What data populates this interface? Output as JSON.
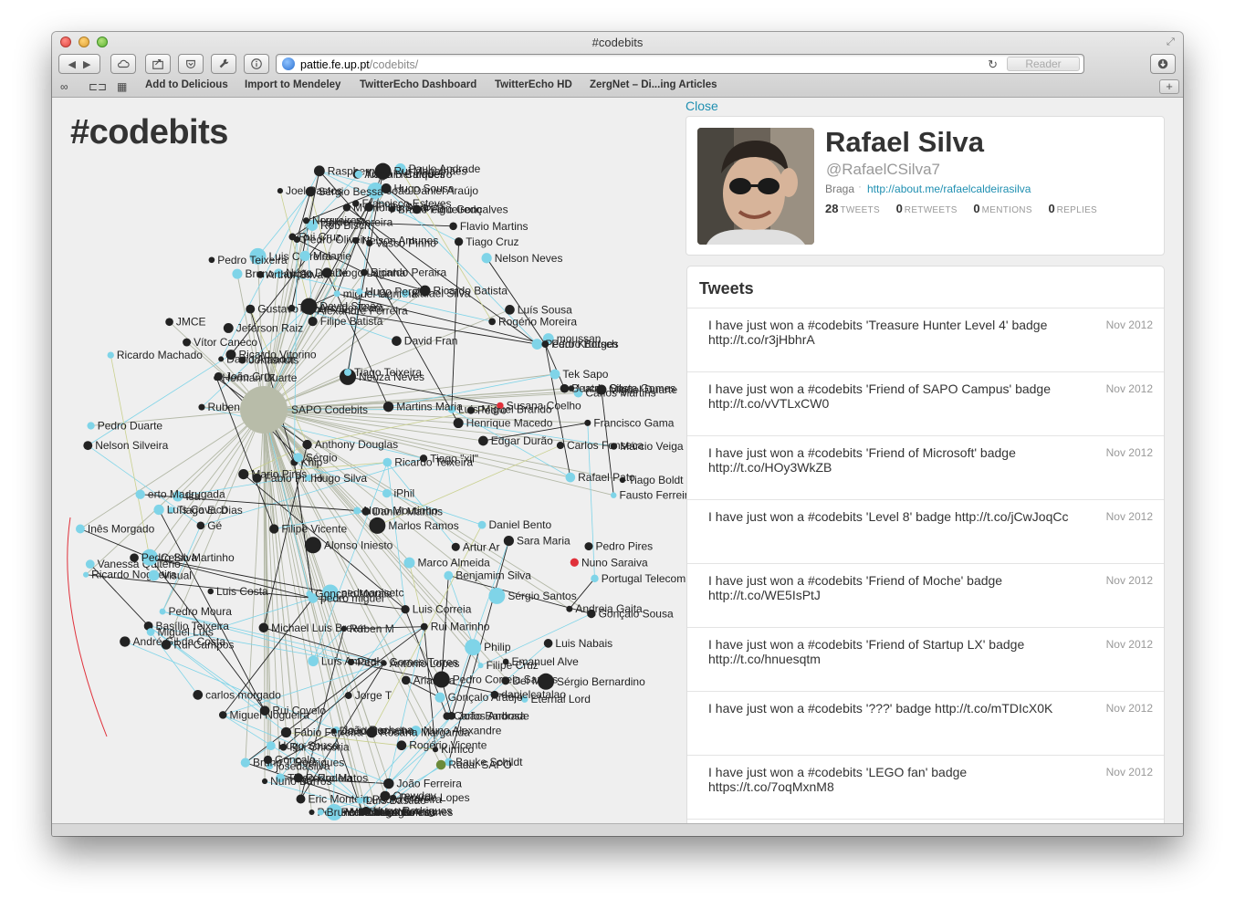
{
  "window": {
    "title": "#codebits"
  },
  "toolbar": {
    "url_host": "pattie.fe.up.pt",
    "url_path": "/codebits/",
    "reader_label": "Reader"
  },
  "bookmarks": [
    "Add to Delicious",
    "Import to Mendeley",
    "TwitterEcho Dashboard",
    "TwitterEcho HD",
    "ZergNet – Di...ing Articles"
  ],
  "page": {
    "title": "#codebits"
  },
  "graph": {
    "nodes": [
      "Paulo Andrade",
      "Raspberry Pi",
      "António Cambeiro",
      "Rui Magalhães",
      "Tiago Henriques",
      "João Daniel Araújo",
      "Sérgio Bessa",
      "Hugo Sousa",
      "Joel Bastos",
      "M√°rio Rui Andr√©",
      "Pedro Gonçalves",
      "Francisco Esteves",
      "Bruno Figueiredo",
      "Filipe Silva",
      "Flavio Martins",
      "Hélder Moreira",
      "Rob Bisch",
      "Nogueiras",
      "Pedro Oliveira",
      "Vasco Pinho",
      "Tiago Cruz",
      "Rui Cruz",
      "Nelson Antunes",
      "Luis Carreira",
      "Pedro Teixeira",
      "Melanie",
      "Nelson Neves",
      "Bruno Lanção",
      "Nuno Duarte",
      "Diogo Laginha",
      "Ricardo Peraira",
      "Arthur Silva",
      "miguel lagrinha",
      "Rafael Silva",
      "Hugo Pereira",
      "Ricardo Batista",
      "Alexandre Ferreira",
      "Gustavo Lobo",
      "The Arcade Team",
      "David Simão",
      "Luís Sousa",
      "Rogério Moreira",
      "Filipe Batista",
      "JMCE",
      "Jeferson Raiz",
      "Vítor Caneco",
      "David Fran",
      "moussan",
      "Pedro Kruttsch",
      "Pedro Borges",
      "Jonasnuts",
      "Ricardo Vitorino",
      "Ricardo Machado",
      "David Amador",
      "Neuza Neves",
      "João Cruz",
      "Herman Duarte",
      "Tek Sapo",
      "Tiago Teixeira",
      "Lucas Silva",
      "Carlos Martins",
      "Beatriz Costa Gomes",
      "Miguel Duarte",
      "Luis Miguel Brando",
      "Rubens Matos",
      "Martins Maria",
      "Susana Coelho",
      "Pedro",
      "SAPO Codebits",
      "Pedro Duarte",
      "Francisco Gama",
      "Henrique Macedo",
      "Nelson Silveira",
      "Carlos Fonseca",
      "Márcio Veiga",
      "Anthony Douglas",
      "Edgar Durão",
      "Khip",
      "Sérgio",
      "Ricardo Teixeira",
      "Tiago \"xil\"",
      "Fábio Pinho",
      "Hugo Silva",
      "Mario Pires",
      "Tiago Boldt Sousa",
      "Rafael Pato",
      "Isa",
      "erto Madrugada",
      "iPhil",
      "Fausto Ferreira",
      "Tiago E. Dias",
      "Luís Cavaco",
      "Daniel Martins",
      "Nuno Moutinho",
      "Filipe Vicente",
      "Inês Morgado",
      "Marlos Ramos",
      "Daniel Bento",
      "Gé",
      "Alonso Iniesto",
      "Sara Maria",
      "Pedro Pires",
      "Artur Ar",
      "Vanessa Quitério",
      "Marco Almeida",
      "Nuno Saraiva",
      "Celso Martinho",
      "Pedro Silva",
      "Ricardo Nogueira",
      "Portugal Telecom",
      "Visual",
      "Benjamim Silva",
      "pedroanicetc",
      "pedro miguel",
      "Sérgio Santos",
      "Gonçalo Morais",
      "Luis Costa",
      "Gonçalo Sousa",
      "Andreia Gaita",
      "Pedro Moura",
      "Luis Correia",
      "Basílio Teixeira",
      "Rui Marinho",
      "Rúben M",
      "Miguel Luís",
      "Michael Luis Brown",
      "André Gil da Costa",
      "Rui Campos",
      "Luis Nabais",
      "Philip",
      "Emanuel Alve",
      "Filipe Cruz",
      "António Lopes",
      "Luís Amaral",
      "Pedro Gomes Torres",
      "Pedro Correia Santos",
      "Arian Pa",
      "Del Mar",
      "Sérgio Bernardino",
      "Jorge T",
      "Eternal Lord",
      "carlos morgado",
      "danielcatalao",
      "Gonçalo Araújo",
      "Carlos Andrade",
      "Rui Covelo",
      "Miguel Nogueira",
      "João Barbosa",
      "Nuno Alexandre",
      "João Rechena",
      "Rosana Margarida",
      "Fábio Ferreira",
      "David Ramalho",
      "Hugo Sousa",
      "Rui Chicória",
      "Kimico",
      "Rogério Vicente",
      "josedasilva",
      "Bauke Schildt",
      "Gonçalo",
      "Bruno T Rodrigues",
      "Radar SAPO",
      "Pedro Matos",
      "João Ferreira",
      "Tiago Rodela",
      "Nuno Barros",
      "Pedro Moreira",
      "Eric Monteiro",
      "Crewdev",
      "Luís Bastião",
      "Ricardo Lopes",
      "Jorge Antunes",
      "Pedro Melo",
      "Hugo Rodrigues",
      "Nuno Nunes",
      "Pedro Cardoso",
      "Diogo Gomes",
      "Marco Amado",
      "Bruno Ferreira"
    ]
  },
  "profile": {
    "close_label": "Close",
    "name": "Rafael Silva",
    "handle": "@RafaelCSilva7",
    "location": "Braga",
    "url": "http://about.me/rafaelcaldeirasilva",
    "stats": [
      {
        "value": "28",
        "label": "TWEETS"
      },
      {
        "value": "0",
        "label": "RETWEETS"
      },
      {
        "value": "0",
        "label": "MENTIONS"
      },
      {
        "value": "0",
        "label": "REPLIES"
      }
    ]
  },
  "tweets": {
    "heading": "Tweets",
    "items": [
      {
        "text": "I have just won a #codebits 'Treasure Hunter Level 4' badge http://t.co/r3jHbhrA",
        "date": "Nov 2012"
      },
      {
        "text": "I have just won a #codebits 'Friend of SAPO Campus' badge http://t.co/vVTLxCW0",
        "date": "Nov 2012"
      },
      {
        "text": "I have just won a #codebits 'Friend of Microsoft' badge http://t.co/HOy3WkZB",
        "date": "Nov 2012"
      },
      {
        "text": "I have just won a #codebits 'Level 8' badge http://t.co/jCwJoqCc",
        "date": "Nov 2012"
      },
      {
        "text": "I have just won a #codebits 'Friend of Moche' badge http://t.co/WE5IsPtJ",
        "date": "Nov 2012"
      },
      {
        "text": "I have just won a #codebits 'Friend of Startup LX' badge http://t.co/hnuesqtm",
        "date": "Nov 2012"
      },
      {
        "text": "I have just won a #codebits '???' badge http://t.co/mTDIcX0K",
        "date": "Nov 2012"
      },
      {
        "text": "I have just won a #codebits 'LEGO fan' badge https://t.co/7oqMxnM8",
        "date": "Nov 2012"
      }
    ]
  },
  "colors": {
    "link": "#1f8fb1",
    "node_dark": "#222222",
    "node_cyan": "#7fd4e8",
    "hub": "#b8bca9",
    "accent_red": "#e0303a"
  }
}
